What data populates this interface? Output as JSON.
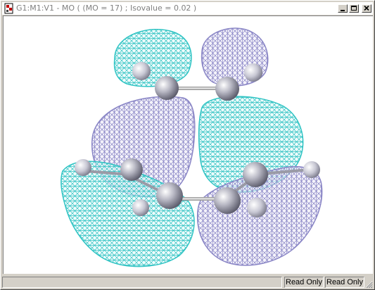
{
  "window": {
    "title": "G1:M1:V1 - MO  ( (MO = 17) ; Isovalue = 0.02 )"
  },
  "controls": {
    "minimize_icon": "minimize-icon",
    "maximize_icon": "maximize-icon",
    "close_icon": "close-icon"
  },
  "viewport": {
    "colors": {
      "background": "#ffffff",
      "lobe_cyan": "#30c4c4",
      "lobe_purple": "#8a86c6",
      "atom": "#c8c8d0",
      "bond": "#b0b0b0"
    }
  },
  "statusbar": {
    "message": "",
    "cell1": "Read Only",
    "cell2": "Read Only"
  }
}
